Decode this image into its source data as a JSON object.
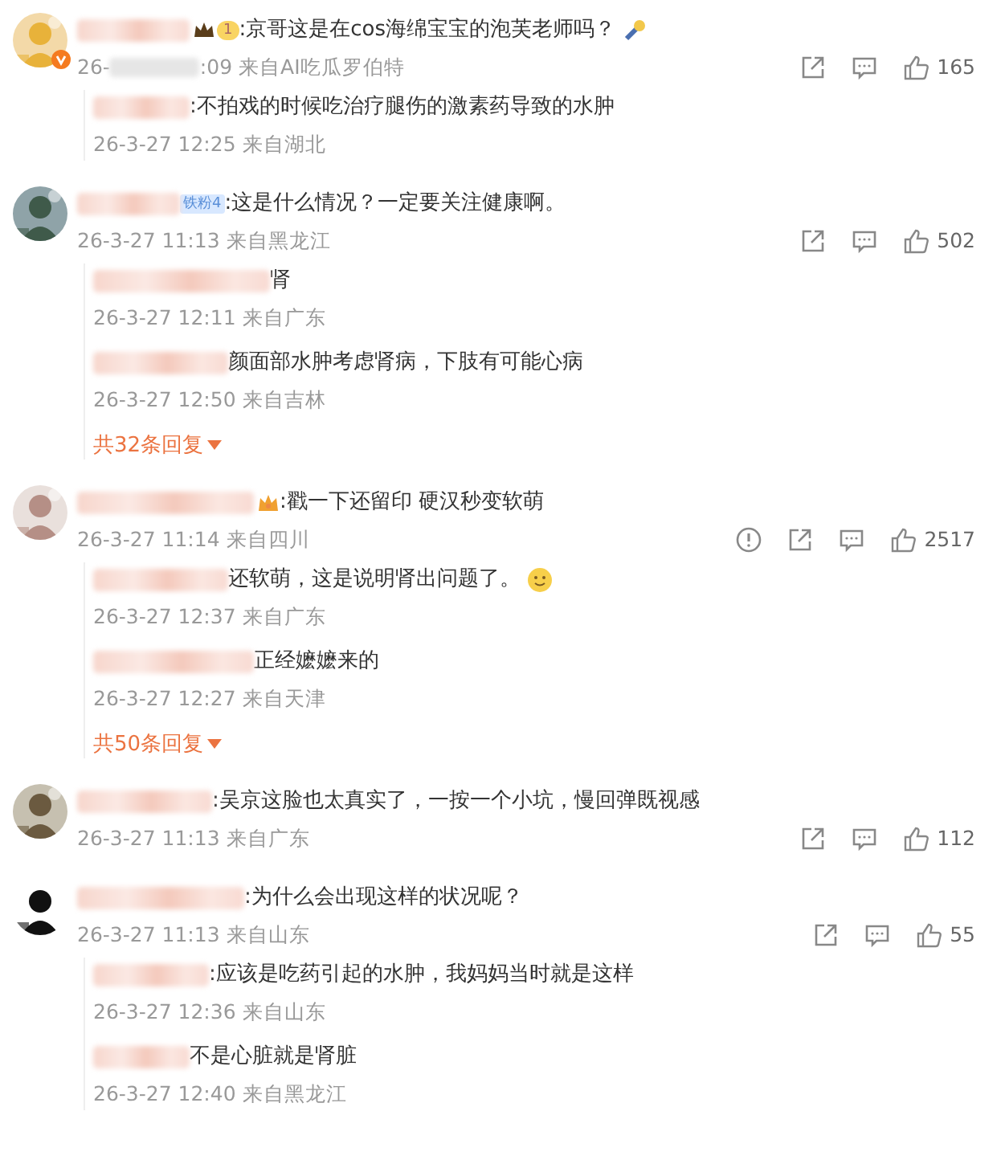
{
  "comments": [
    {
      "avatar": {
        "kind": "picture",
        "verified": true
      },
      "badge": {
        "kind": "crown-level",
        "text": "1"
      },
      "text": ":京哥这是在cos海绵宝宝的泡芙老师吗？",
      "emoji": {
        "kind": "wand"
      },
      "date": "26-",
      "date_tail": ":09",
      "location": "来自AI吃瓜罗伯特",
      "report": false,
      "likes": "165",
      "replies": [
        {
          "text": ":不拍戏的时候吃治疗腿伤的激素药导致的水肿",
          "date": "26-3-27 12:25",
          "location": "来自湖北"
        }
      ]
    },
    {
      "avatar": {
        "kind": "picture",
        "verified": false
      },
      "badge": {
        "kind": "fan",
        "text": "铁粉4"
      },
      "text": ":这是什么情况？一定要关注健康啊。",
      "date": "26-3-27 11:13",
      "location": "来自黑龙江",
      "report": false,
      "likes": "502",
      "replies": [
        {
          "name_tail": "肾",
          "date": "26-3-27 12:11",
          "location": "来自广东"
        },
        {
          "text": "颜面部水肿考虑肾病，下肢有可能心病",
          "date": "26-3-27 12:50",
          "location": "来自吉林"
        }
      ],
      "more": "共32条回复"
    },
    {
      "avatar": {
        "kind": "picture",
        "verified": false
      },
      "badge": {
        "kind": "crown"
      },
      "text": ":戳一下还留印 硬汉秒变软萌",
      "date": "26-3-27 11:14",
      "location": "来自四川",
      "report": true,
      "likes": "2517",
      "replies": [
        {
          "text": "还软萌，这是说明肾出问题了。",
          "emoji": {
            "kind": "smile"
          },
          "date": "26-3-27 12:37",
          "location": "来自广东"
        },
        {
          "text": "正经嬷嬷来的",
          "date": "26-3-27 12:27",
          "location": "来自天津"
        }
      ],
      "more": "共50条回复"
    },
    {
      "avatar": {
        "kind": "picture",
        "verified": false
      },
      "badge": {
        "kind": "none"
      },
      "text": ":吴京这脸也太真实了，一按一个小坑，慢回弹既视感",
      "date": "26-3-27 11:13",
      "location": "来自广东",
      "report": false,
      "likes": "112"
    },
    {
      "avatar": {
        "kind": "picture",
        "verified": false
      },
      "badge": {
        "kind": "none"
      },
      "text": ":为什么会出现这样的状况呢？",
      "date": "26-3-27 11:13",
      "location": "来自山东",
      "report": false,
      "likes": "55",
      "replies": [
        {
          "text": ":应该是吃药引起的水肿，我妈妈当时就是这样",
          "date": "26-3-27 12:36",
          "location": "来自山东"
        },
        {
          "text": "不是心脏就是肾脏",
          "date": "26-3-27 12:40",
          "location": "来自黑龙江"
        }
      ]
    }
  ]
}
